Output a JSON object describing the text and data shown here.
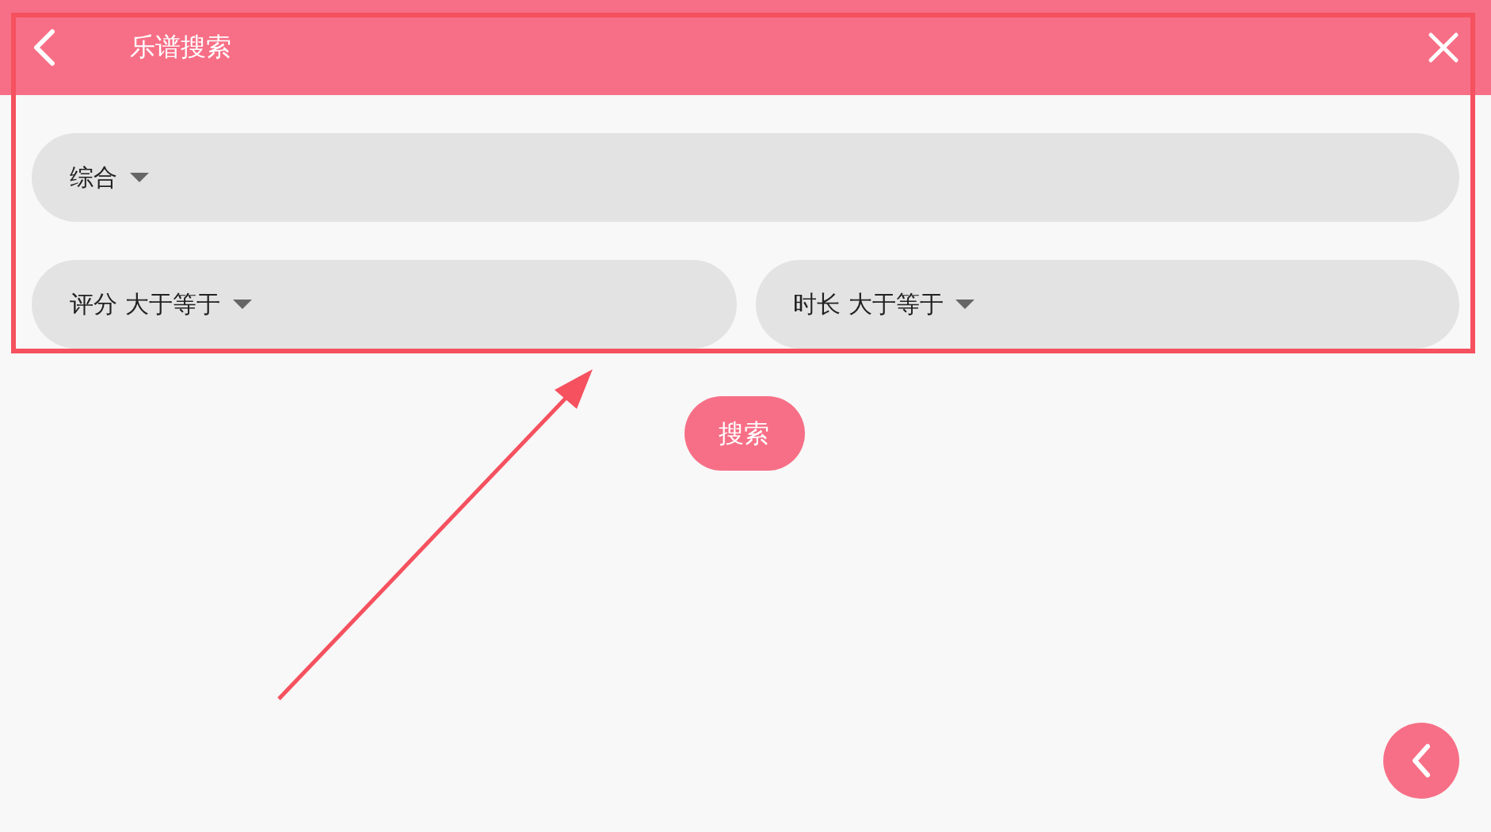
{
  "header": {
    "title": "乐谱搜索"
  },
  "filters": [
    {
      "label": "综合"
    },
    {
      "label": "评分 大于等于"
    },
    {
      "label": "时长 大于等于"
    }
  ],
  "search_button": "搜索"
}
